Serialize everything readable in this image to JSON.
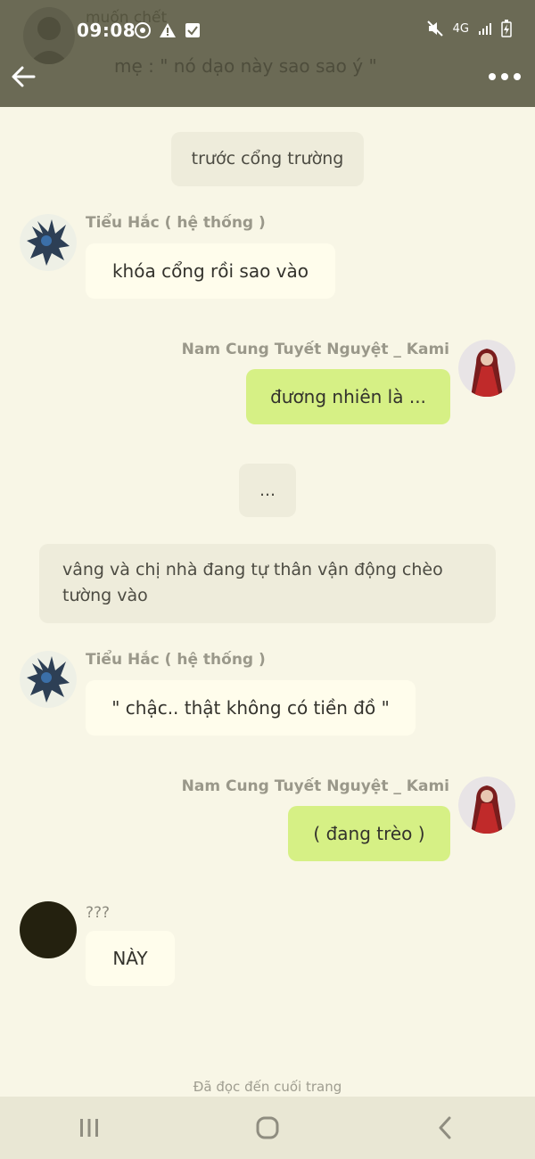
{
  "status_bar": {
    "time": "09:08",
    "network": "4G"
  },
  "header": {
    "ghost_author": "muốn chết",
    "ghost_preview": "mẹ : \" nó dạo này sao sao ý \""
  },
  "messages": [
    {
      "type": "narration",
      "text": "trước cổng trường"
    },
    {
      "type": "incoming",
      "sender": "Tiểu Hắc ( hệ thống )",
      "text": "khóa cổng rồi sao vào"
    },
    {
      "type": "outgoing",
      "sender": "Nam Cung Tuyết Nguyệt _ Kami",
      "text": "đương nhiên là ..."
    },
    {
      "type": "narration",
      "text": "..."
    },
    {
      "type": "narration",
      "text": "vâng và chị nhà đang tự thân vận động chèo tường vào"
    },
    {
      "type": "incoming",
      "sender": "Tiểu Hắc ( hệ thống )",
      "text": "\" chậc.. thật không có tiền đồ \""
    },
    {
      "type": "outgoing",
      "sender": "Nam Cung Tuyết Nguyệt _ Kami",
      "text": "( đang trèo )"
    },
    {
      "type": "incoming",
      "sender": "???",
      "text": "NÀY"
    }
  ],
  "footer_note": "Đã đọc đến cuối trang",
  "colors": {
    "header_bg": "#6b6a55",
    "page_bg": "#f8f6e6",
    "incoming_bubble": "#fffdec",
    "outgoing_bubble": "#d6f085",
    "narration_bg": "#eeecdb"
  }
}
